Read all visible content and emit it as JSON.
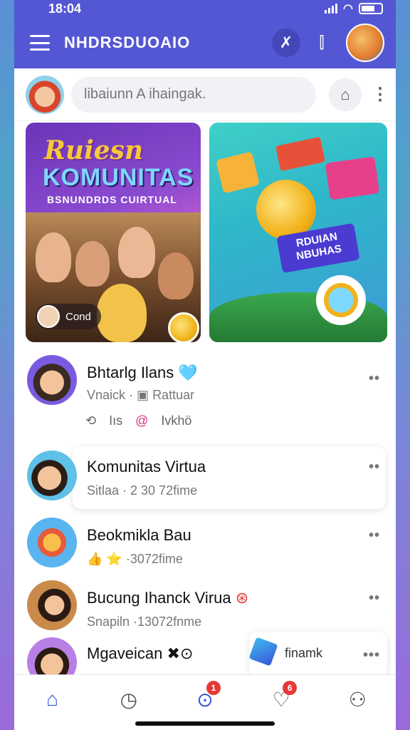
{
  "status": {
    "time": "18:04"
  },
  "appbar": {
    "title": "NHDRSDUOAIO",
    "icons": [
      "menu-icon",
      "crossed-icon",
      "bars-icon",
      "profile-avatar"
    ]
  },
  "search": {
    "placeholder": "libaiunn A ihaingak."
  },
  "banners": {
    "left": {
      "script_title": "Ruiesn",
      "title": "KOMUNITAS",
      "subtitle": "BSNUNDRDS CUIRTUAL",
      "tag": "Cond"
    },
    "right": {
      "label": "RDUIAN NBUHAS"
    }
  },
  "feed": [
    {
      "name": "Bhtarlg Ilans",
      "meta_left": "Vnaick",
      "meta_right": "Rattuar",
      "action_left": "Iıs",
      "action_right": "Ivkhö",
      "emoji": "🩵"
    },
    {
      "name": "Komunitas Virtua",
      "meta": "Sitlaa · 2 30 72fime"
    },
    {
      "name": "Beokmikla Bau",
      "meta": "👍 ⭐ ·3072fime"
    },
    {
      "name": "Bucung Ihanck Virua",
      "meta": "Snapiln ·13072fnme"
    },
    {
      "name": "Mgaveican",
      "suffix": "✖⊙",
      "promo": "finamk"
    }
  ],
  "tabbar": {
    "tabs": [
      {
        "name": "home",
        "icon": "home-icon",
        "badge": ""
      },
      {
        "name": "explore",
        "icon": "compass-icon",
        "badge": ""
      },
      {
        "name": "search",
        "icon": "search-icon",
        "badge": "1"
      },
      {
        "name": "notifications",
        "icon": "heart-icon",
        "badge": "6"
      },
      {
        "name": "profile",
        "icon": "person-icon",
        "badge": ""
      }
    ]
  },
  "colors": {
    "brand": "#5457d3",
    "active_tab": "#3a57d6",
    "badge": "#e53935"
  }
}
